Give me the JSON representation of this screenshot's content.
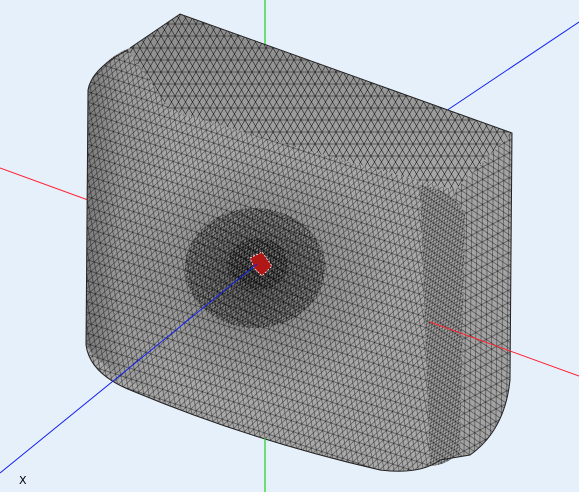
{
  "viewport": {
    "background": "#e6f0fb"
  },
  "model": {
    "kind": "tetrahedral-mesh-block",
    "face_color": "#a9a9a9",
    "edge_color": "#000000",
    "defect_color": "#b01818"
  },
  "axes": {
    "x_color": "#ff2030",
    "y_color": "#20d020",
    "z_color": "#1020f0"
  },
  "triad": {
    "x_label": "X"
  }
}
